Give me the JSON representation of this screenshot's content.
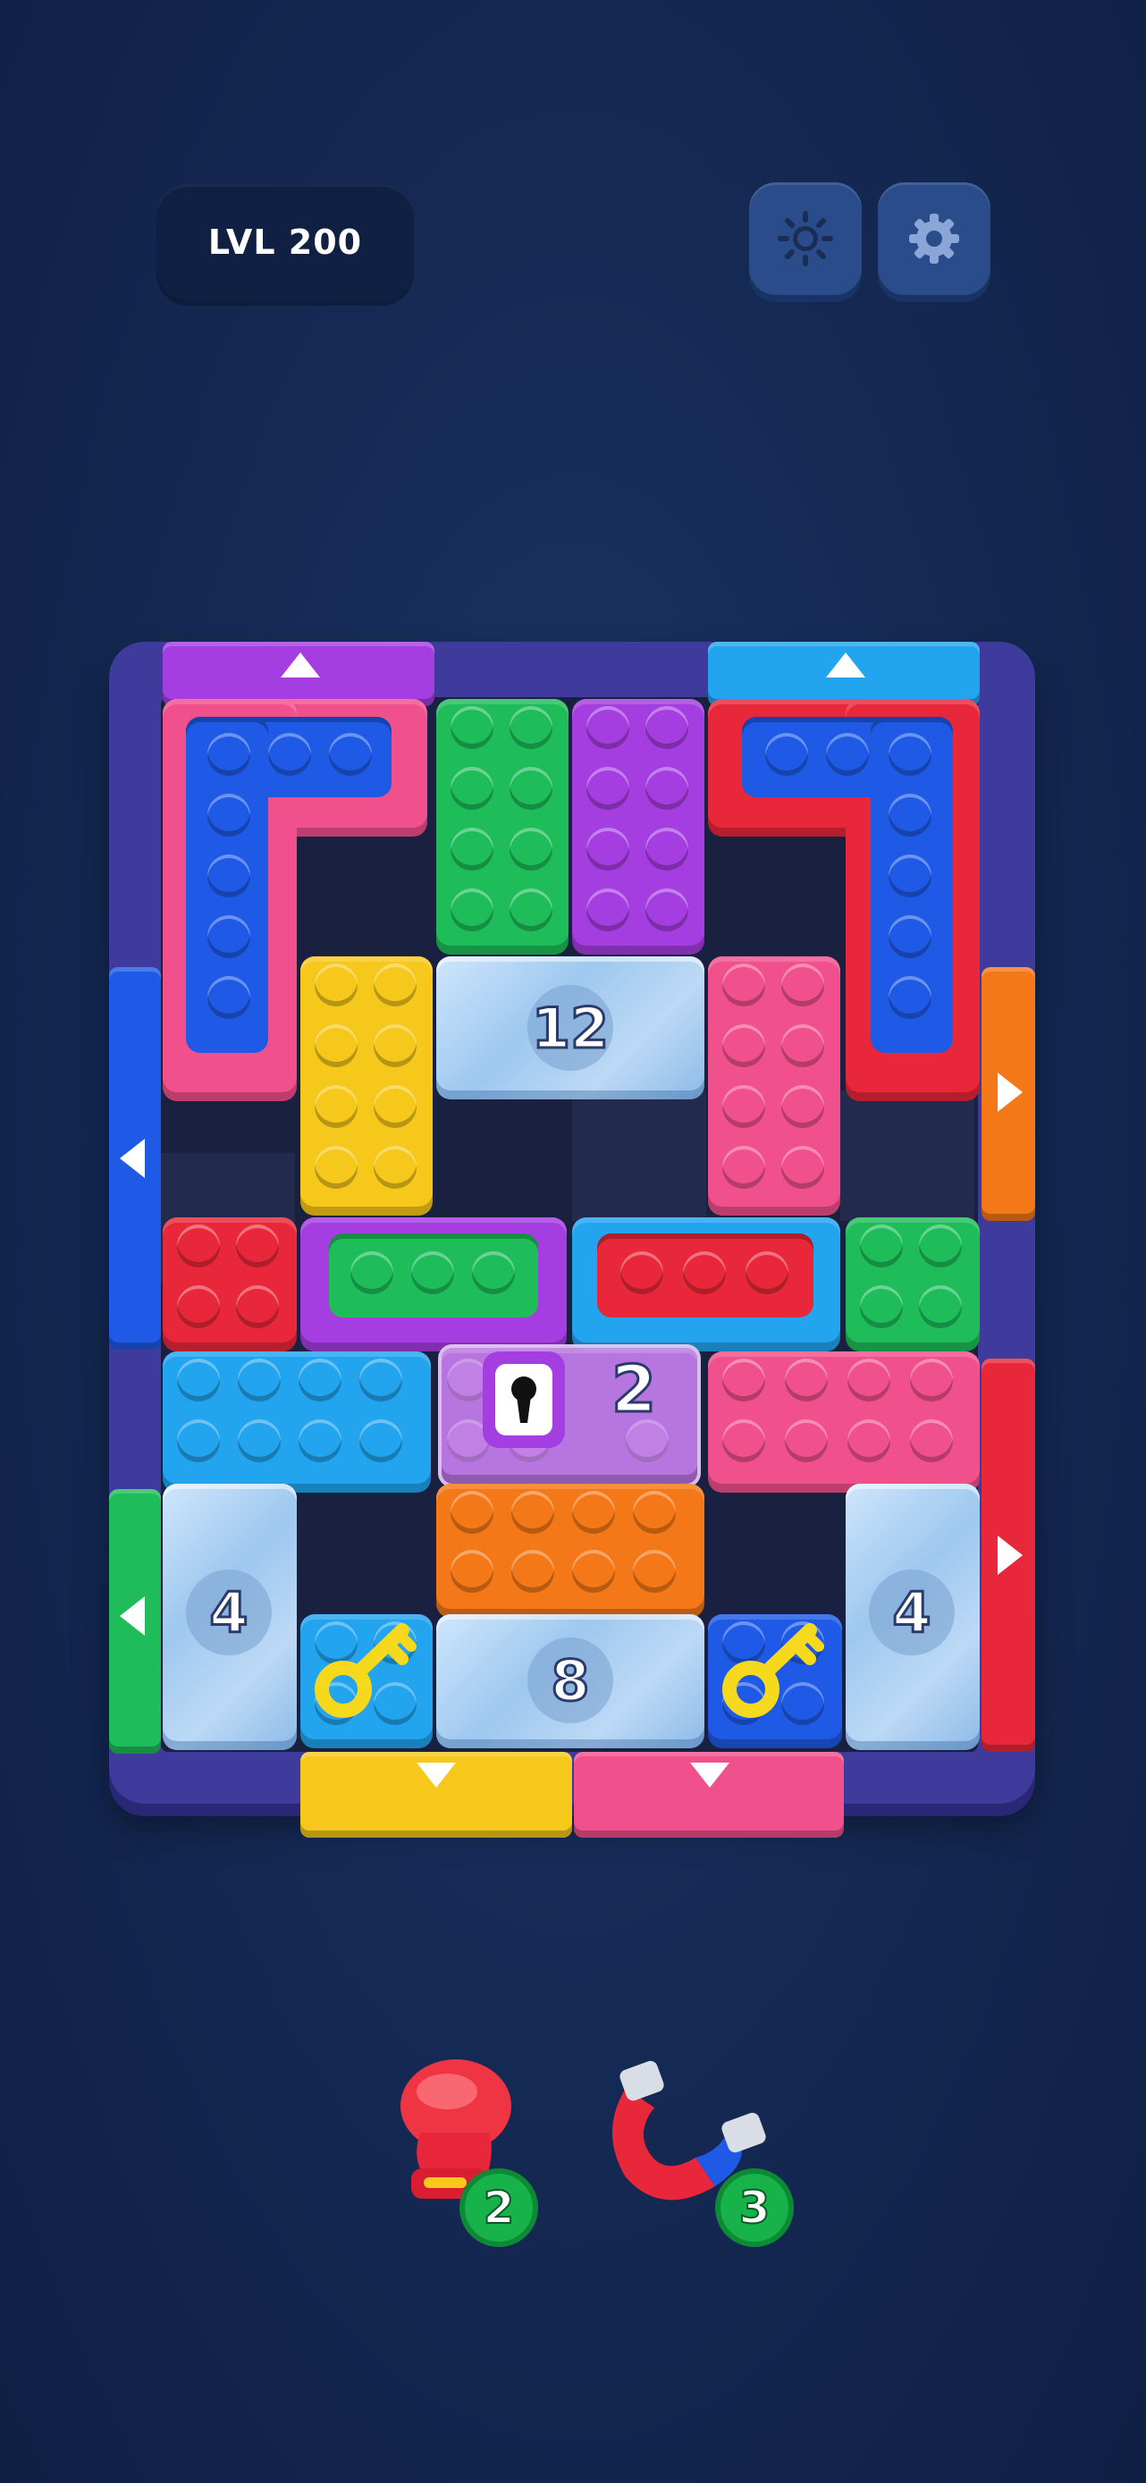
{
  "hud": {
    "level_label": "LVL 200",
    "theme_icon": "sun-icon",
    "settings_icon": "gear-icon"
  },
  "board": {
    "frame_color": "#3e3b9c",
    "ice_blocks": [
      {
        "id": "ice-12",
        "count": "12"
      },
      {
        "id": "ice-left-4",
        "count": "4"
      },
      {
        "id": "ice-8",
        "count": "8"
      },
      {
        "id": "ice-right-4",
        "count": "4"
      }
    ],
    "locked_block": {
      "count": "2",
      "icon": "keyhole-icon"
    },
    "keys": [
      "key-icon",
      "key-icon"
    ],
    "colors": {
      "purple": "#a43ee0",
      "blue": "#1e5ae6",
      "cyan": "#22a4ee",
      "green": "#1ebd5a",
      "pink": "#f0508c",
      "red": "#e8283a",
      "yellow": "#f6c81c",
      "orange": "#f47818"
    }
  },
  "boosters": [
    {
      "name": "boxing-glove",
      "icon": "boxing-glove-icon",
      "count": "2"
    },
    {
      "name": "magnet",
      "icon": "magnet-icon",
      "count": "3"
    }
  ]
}
